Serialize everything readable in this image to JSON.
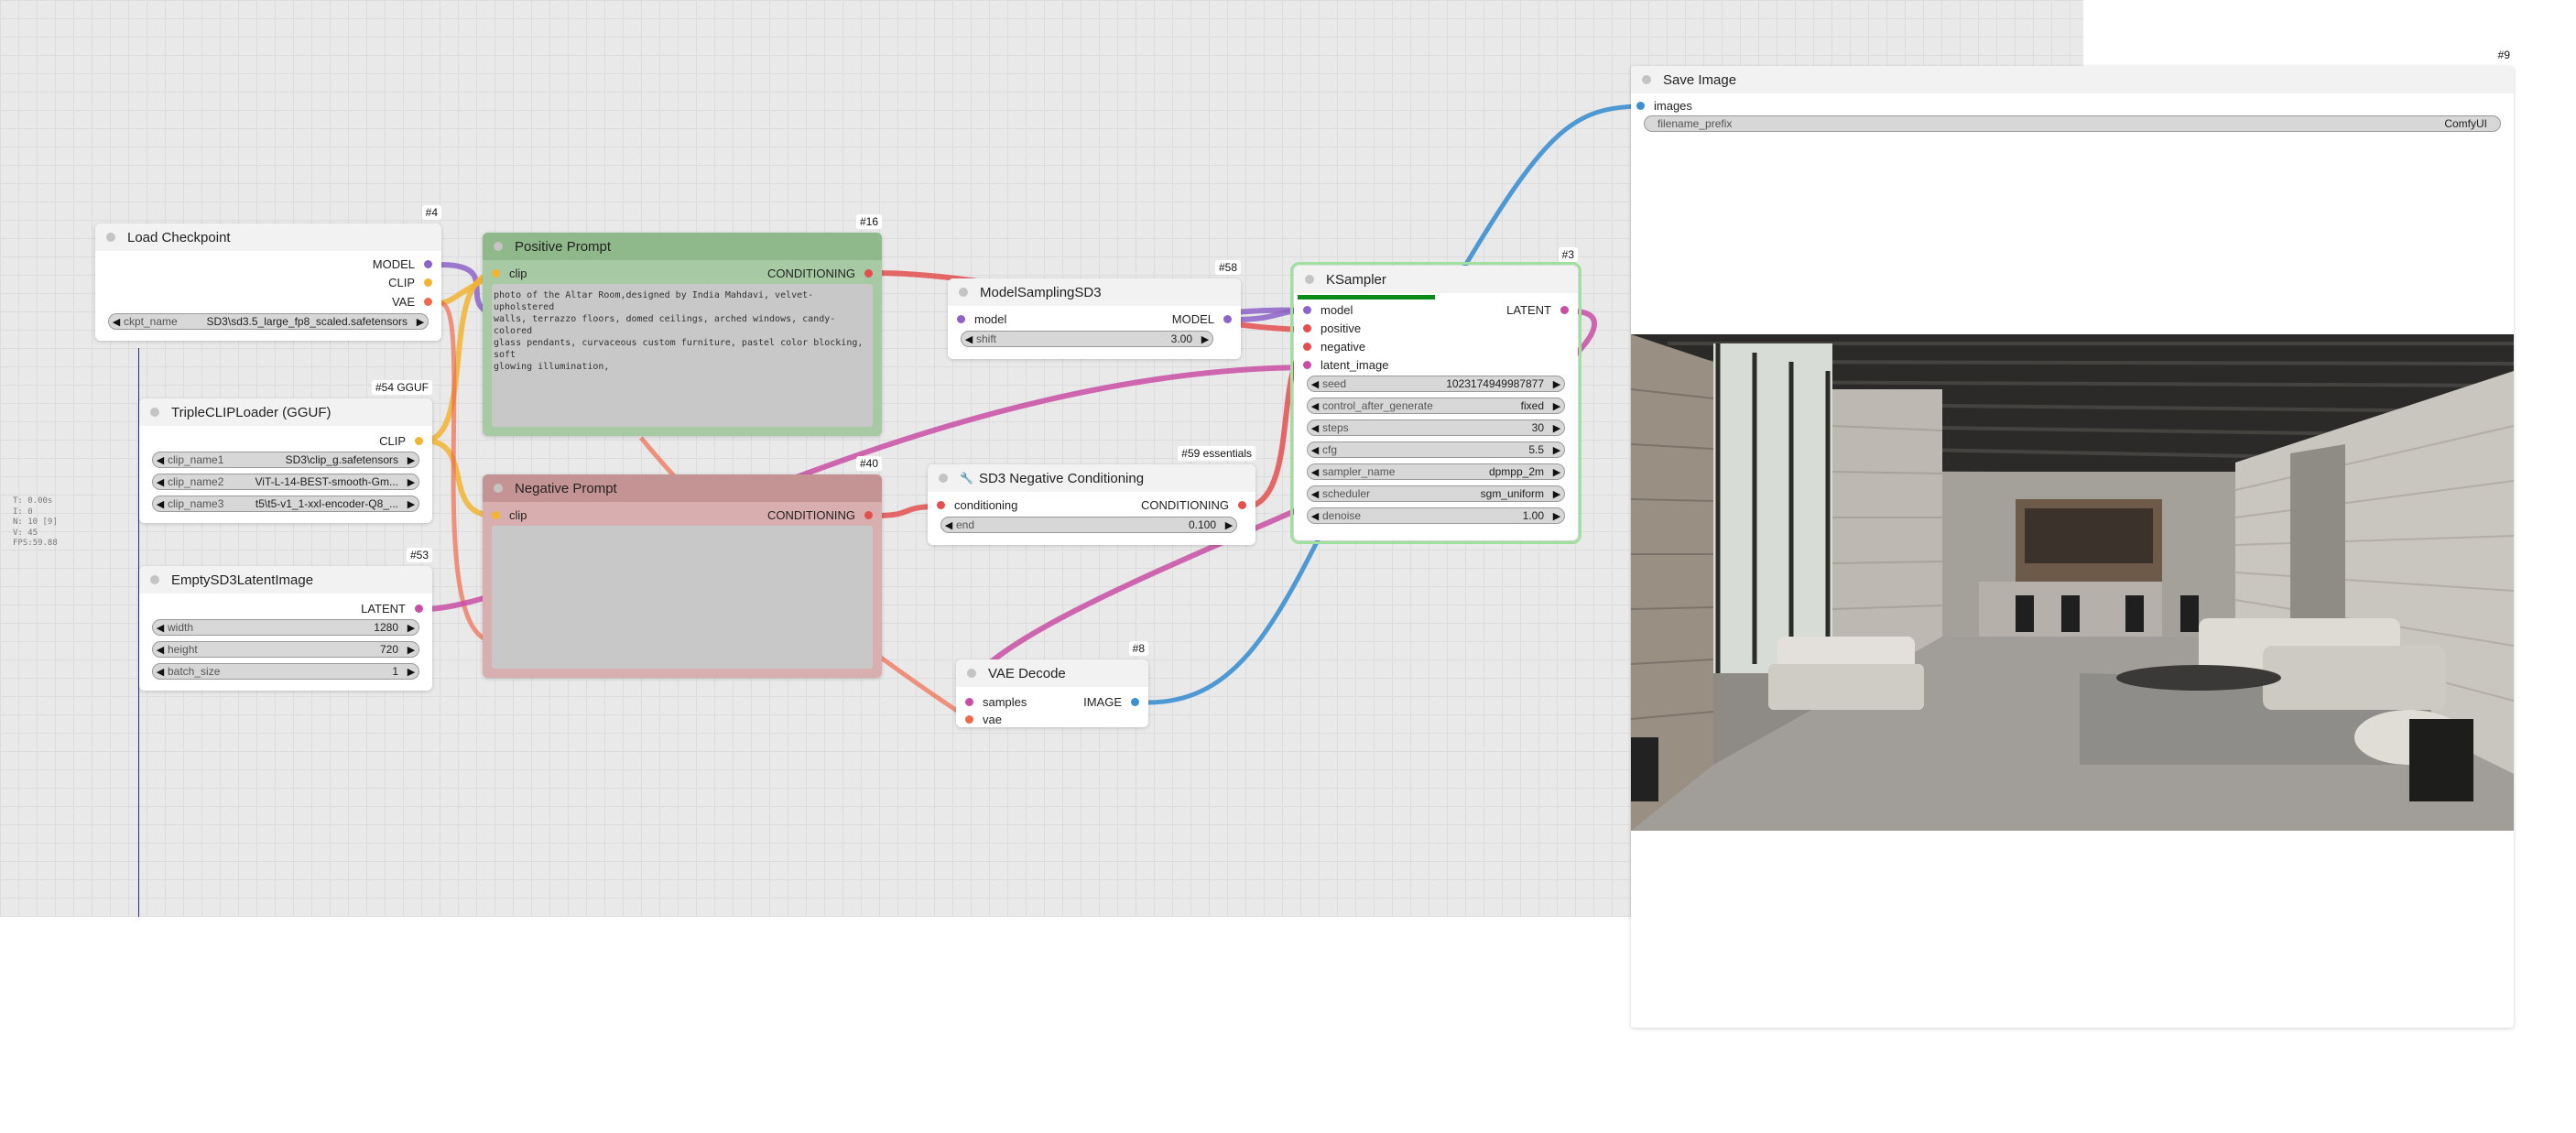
{
  "stats": {
    "lines": [
      "T: 0.00s",
      "I: 0",
      "N: 10 [9]",
      "V: 45",
      "FPS:59.88"
    ]
  },
  "colors": {
    "model": "#8e63c9",
    "clip": "#f0b431",
    "vae": "#ef6a4b",
    "conditioning": "#e34f4f",
    "latent": "#c84fa5",
    "image": "#3d90d0",
    "positive_bg": "#a7c9a3",
    "negative_bg": "#d9aeae",
    "progress": "#0a8a16"
  },
  "load_checkpoint": {
    "id": "#4",
    "title": "Load Checkpoint",
    "outputs": [
      "MODEL",
      "CLIP",
      "VAE"
    ],
    "ckpt_label": "ckpt_name",
    "ckpt_value": "SD3\\sd3.5_large_fp8_scaled.safetensors"
  },
  "triple_clip": {
    "id": "#54 GGUF",
    "title": "TripleCLIPLoader (GGUF)",
    "output": "CLIP",
    "widgets": [
      {
        "label": "clip_name1",
        "value": "SD3\\clip_g.safetensors"
      },
      {
        "label": "clip_name2",
        "value": "ViT-L-14-BEST-smooth-Gm..."
      },
      {
        "label": "clip_name3",
        "value": "t5\\t5-v1_1-xxl-encoder-Q8_..."
      }
    ]
  },
  "empty_latent": {
    "id": "#53",
    "title": "EmptySD3LatentImage",
    "output": "LATENT",
    "widgets": [
      {
        "label": "width",
        "value": "1280"
      },
      {
        "label": "height",
        "value": "720"
      },
      {
        "label": "batch_size",
        "value": "1"
      }
    ]
  },
  "positive_prompt": {
    "id": "#16",
    "title": "Positive Prompt",
    "input": "clip",
    "output": "CONDITIONING",
    "text": "photo of the Altar Room,designed by India Mahdavi, velvet-upholstered\nwalls, terrazzo floors, domed ceilings, arched windows, candy-colored\nglass pendants, curvaceous custom furniture, pastel color blocking, soft\nglowing illumination,"
  },
  "negative_prompt": {
    "id": "#40",
    "title": "Negative Prompt",
    "input": "clip",
    "output": "CONDITIONING"
  },
  "model_sampling": {
    "id": "#58",
    "title": "ModelSamplingSD3",
    "input": "model",
    "output": "MODEL",
    "shift_label": "shift",
    "shift_value": "3.00"
  },
  "sd3_negative": {
    "id": "#59 essentials",
    "title": "SD3 Negative Conditioning",
    "icon_glyph": "🔧",
    "input": "conditioning",
    "output": "CONDITIONING",
    "end_label": "end",
    "end_value": "0.100"
  },
  "ksampler": {
    "id": "#3",
    "title": "KSampler",
    "progress": 0.5,
    "inputs": [
      "model",
      "positive",
      "negative",
      "latent_image"
    ],
    "output": "LATENT",
    "widgets": [
      {
        "label": "seed",
        "value": "1023174949987877"
      },
      {
        "label": "control_after_generate",
        "value": "fixed"
      },
      {
        "label": "steps",
        "value": "30"
      },
      {
        "label": "cfg",
        "value": "5.5"
      },
      {
        "label": "sampler_name",
        "value": "dpmpp_2m"
      },
      {
        "label": "scheduler",
        "value": "sgm_uniform"
      },
      {
        "label": "denoise",
        "value": "1.00"
      }
    ]
  },
  "vae_decode": {
    "id": "#8",
    "title": "VAE Decode",
    "inputs": [
      "samples",
      "vae"
    ],
    "output": "IMAGE"
  },
  "save_image": {
    "id": "#9",
    "title": "Save Image",
    "input": "images",
    "prefix_label": "filename_prefix",
    "prefix_value": "ComfyUI"
  },
  "glyphs": {
    "left": "◀",
    "right": "▶"
  }
}
